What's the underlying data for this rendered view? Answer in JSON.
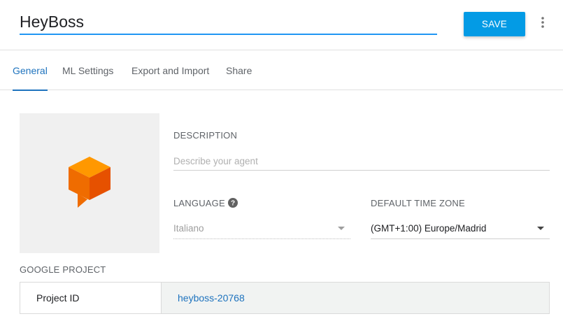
{
  "header": {
    "agent_name": "HeyBoss",
    "save_label": "SAVE"
  },
  "tabs": [
    {
      "label": "General",
      "active": true
    },
    {
      "label": "ML Settings",
      "active": false
    },
    {
      "label": "Export and Import",
      "active": false
    },
    {
      "label": "Share",
      "active": false
    }
  ],
  "general": {
    "description_label": "DESCRIPTION",
    "description_placeholder": "Describe your agent",
    "description_value": "",
    "language_label": "LANGUAGE",
    "language_value": "Italiano",
    "timezone_label": "DEFAULT TIME ZONE",
    "timezone_value": "(GMT+1:00) Europe/Madrid"
  },
  "google_project": {
    "section_label": "GOOGLE PROJECT",
    "project_id_label": "Project ID",
    "project_id_value": "heyboss-20768"
  },
  "icons": {
    "logo": "dialogflow-logo-icon",
    "more": "more-vert-icon",
    "help": "help-icon",
    "dropdown": "chevron-down-icon"
  },
  "colors": {
    "accent": "#039be5",
    "tab_active": "#1e73be",
    "input_underline": "#2196f3",
    "logo_orange": "#ef6c00"
  }
}
